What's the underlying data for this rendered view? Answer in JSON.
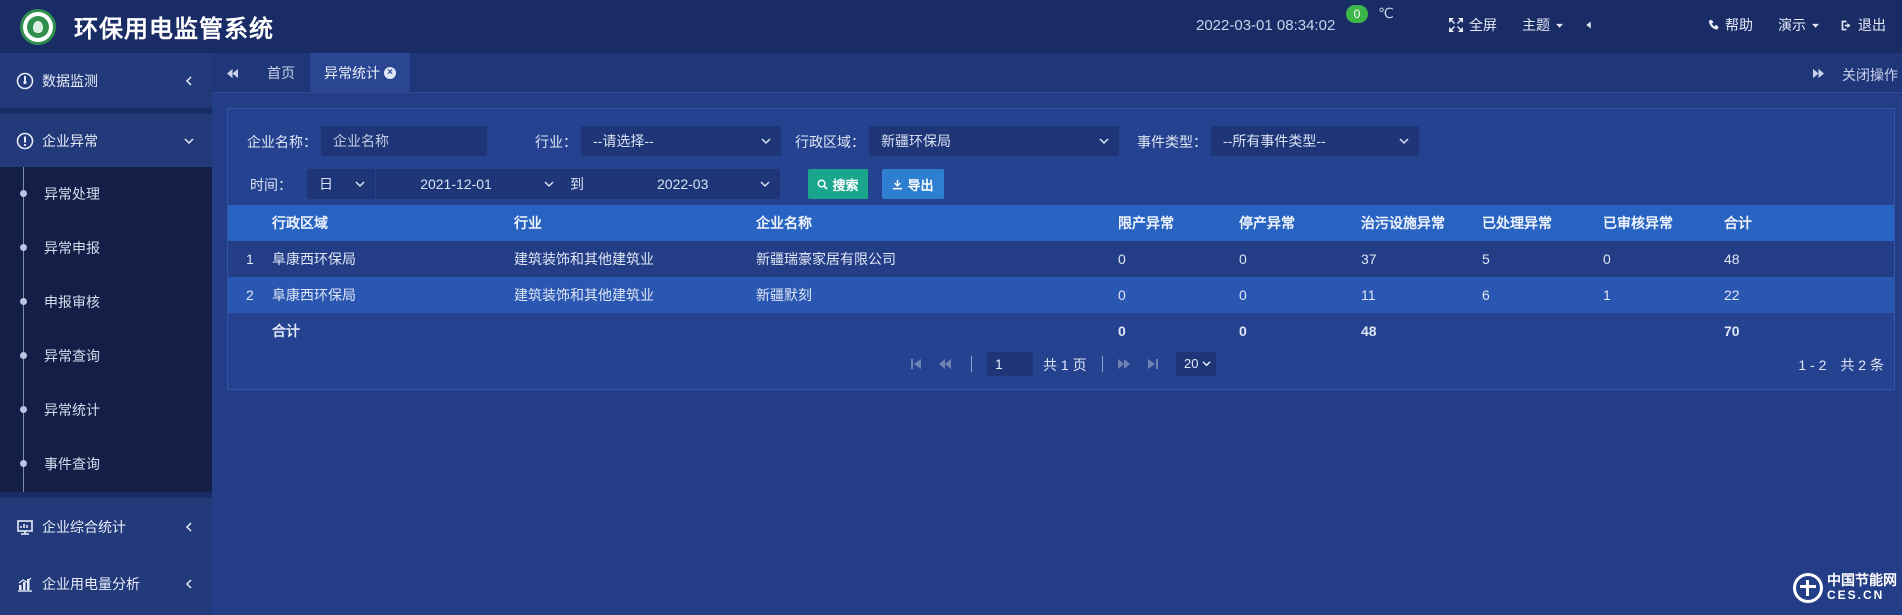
{
  "header": {
    "title": "环保用电监管系统",
    "datetime": "2022-03-01  08:34:02",
    "temp_value": "0",
    "temp_unit": "℃",
    "fullscreen_label": "全屏",
    "theme_label": "主题",
    "help_label": "帮助",
    "demo_label": "演示",
    "logout_label": "退出"
  },
  "sidebar": {
    "menus": [
      {
        "label": "数据监测",
        "icon": "dashboard-icon"
      },
      {
        "label": "企业异常",
        "icon": "alert-circle-icon"
      },
      {
        "label": "企业综合统计",
        "icon": "report-icon"
      },
      {
        "label": "企业用电量分析",
        "icon": "bar-chart-icon"
      }
    ],
    "submenu": [
      {
        "label": "异常处理"
      },
      {
        "label": "异常申报"
      },
      {
        "label": "申报审核"
      },
      {
        "label": "异常查询"
      },
      {
        "label": "异常统计"
      },
      {
        "label": "事件查询"
      }
    ]
  },
  "tabs": {
    "items": [
      {
        "label": "首页"
      },
      {
        "label": "异常统计"
      }
    ],
    "close_ops_label": "关闭操作"
  },
  "filters": {
    "company_label": "企业名称：",
    "company_placeholder": "企业名称",
    "industry_label": "行业：",
    "industry_value": "--请选择--",
    "region_label": "行政区域：",
    "region_value": "新疆环保局",
    "event_label": "事件类型：",
    "event_value": "--所有事件类型--",
    "time_label": "时间：",
    "time_unit": "日",
    "start_date": "2021-12-01",
    "to_label": "到",
    "end_date": "2022-03",
    "search_label": "搜索",
    "export_label": "导出"
  },
  "table": {
    "columns": [
      "行政区域",
      "行业",
      "企业名称",
      "限产异常",
      "停产异常",
      "治污设施异常",
      "已处理异常",
      "已审核异常",
      "合计"
    ],
    "rows": [
      {
        "index": "1",
        "region": "阜康西环保局",
        "industry": "建筑装饰和其他建筑业",
        "company": "新疆瑞豪家居有限公司",
        "limit": "0",
        "stop": "0",
        "pollution": "37",
        "handled": "5",
        "reviewed": "0",
        "total": "48"
      },
      {
        "index": "2",
        "region": "阜康西环保局",
        "industry": "建筑装饰和其他建筑业",
        "company": "新疆默刻",
        "limit": "0",
        "stop": "0",
        "pollution": "11",
        "handled": "6",
        "reviewed": "1",
        "total": "22"
      }
    ],
    "summary": {
      "label": "合计",
      "limit": "0",
      "stop": "0",
      "pollution": "48",
      "total": "70"
    }
  },
  "pagination": {
    "current_page": "1",
    "total_pages": "共 1 页",
    "page_size": "20",
    "range_info": "1 - 2　共 2 条"
  },
  "watermark": {
    "line1": "中国节能网",
    "line2": "CES.CN"
  }
}
